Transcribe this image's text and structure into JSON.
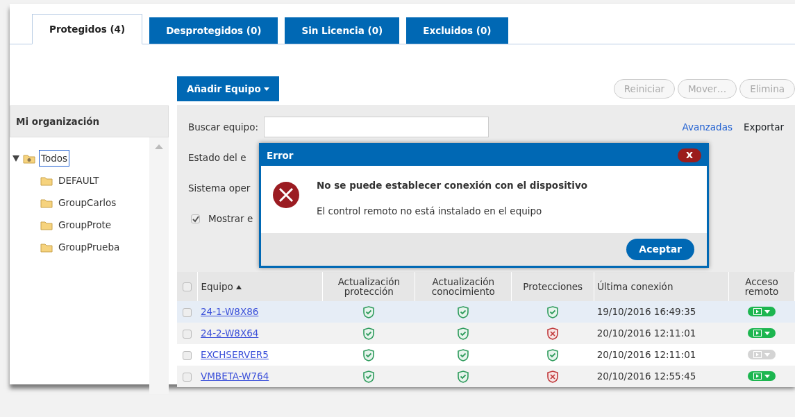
{
  "tabs": [
    {
      "label": "Protegidos (4)",
      "selected": true
    },
    {
      "label": "Desprotegidos (0)",
      "selected": false
    },
    {
      "label": "Sin Licencia (0)",
      "selected": false
    },
    {
      "label": "Excluidos (0)",
      "selected": false
    }
  ],
  "toolbar": {
    "add_button": "Añadir Equipo",
    "actions": [
      {
        "label": "Reiniciar",
        "disabled": true
      },
      {
        "label": "Mover…",
        "disabled": true
      },
      {
        "label": "Elimina",
        "disabled": true
      }
    ]
  },
  "sidebar": {
    "title": "Mi organización",
    "tree": [
      {
        "label": "Todos",
        "expanded": true,
        "selected": true,
        "children": [
          {
            "label": "DEFAULT",
            "selected": false
          },
          {
            "label": "GroupCarlos",
            "selected": false
          },
          {
            "label": "GroupProte",
            "selected": false
          },
          {
            "label": "GroupPrueba",
            "selected": false
          }
        ]
      }
    ]
  },
  "filters": {
    "search_label": "Buscar equipo:",
    "advanced_link": "Avanzadas",
    "export_link": "Exportar",
    "fields": [
      {
        "label": "Estado del e"
      },
      {
        "label": "Sistema oper"
      }
    ],
    "show_checkbox": {
      "label": "Mostrar e",
      "checked": true
    }
  },
  "table": {
    "select_all_checked": false,
    "columns": [
      "Equipo",
      "Actualización protección",
      "Actualización conocimiento",
      "Protecciones",
      "Última conexión",
      "Acceso remoto"
    ],
    "rows": [
      {
        "name": "24-1-W8X86",
        "protection_updated": true,
        "knowledge_updated": true,
        "protected": true,
        "last_connection": "19/10/2016 16:49:35",
        "remote_enabled": true,
        "checked": false,
        "selected": true
      },
      {
        "name": "24-2-W8X64",
        "protection_updated": true,
        "knowledge_updated": true,
        "protected": false,
        "last_connection": "20/10/2016 12:11:01",
        "remote_enabled": true,
        "checked": false,
        "selected": false
      },
      {
        "name": "EXCHSERVER5",
        "protection_updated": true,
        "knowledge_updated": true,
        "protected": true,
        "last_connection": "20/10/2016 12:11:01",
        "remote_enabled": false,
        "checked": false,
        "selected": false
      },
      {
        "name": "VMBETA-W764",
        "protection_updated": true,
        "knowledge_updated": true,
        "protected": false,
        "last_connection": "20/10/2016 12:55:45",
        "remote_enabled": true,
        "checked": false,
        "selected": false
      }
    ]
  },
  "dialog": {
    "title": "Error",
    "close": "X",
    "heading": "No se puede establecer conexión con el dispositivo",
    "message": "El control remoto no está instalado en el equipo",
    "button": "Aceptar"
  }
}
